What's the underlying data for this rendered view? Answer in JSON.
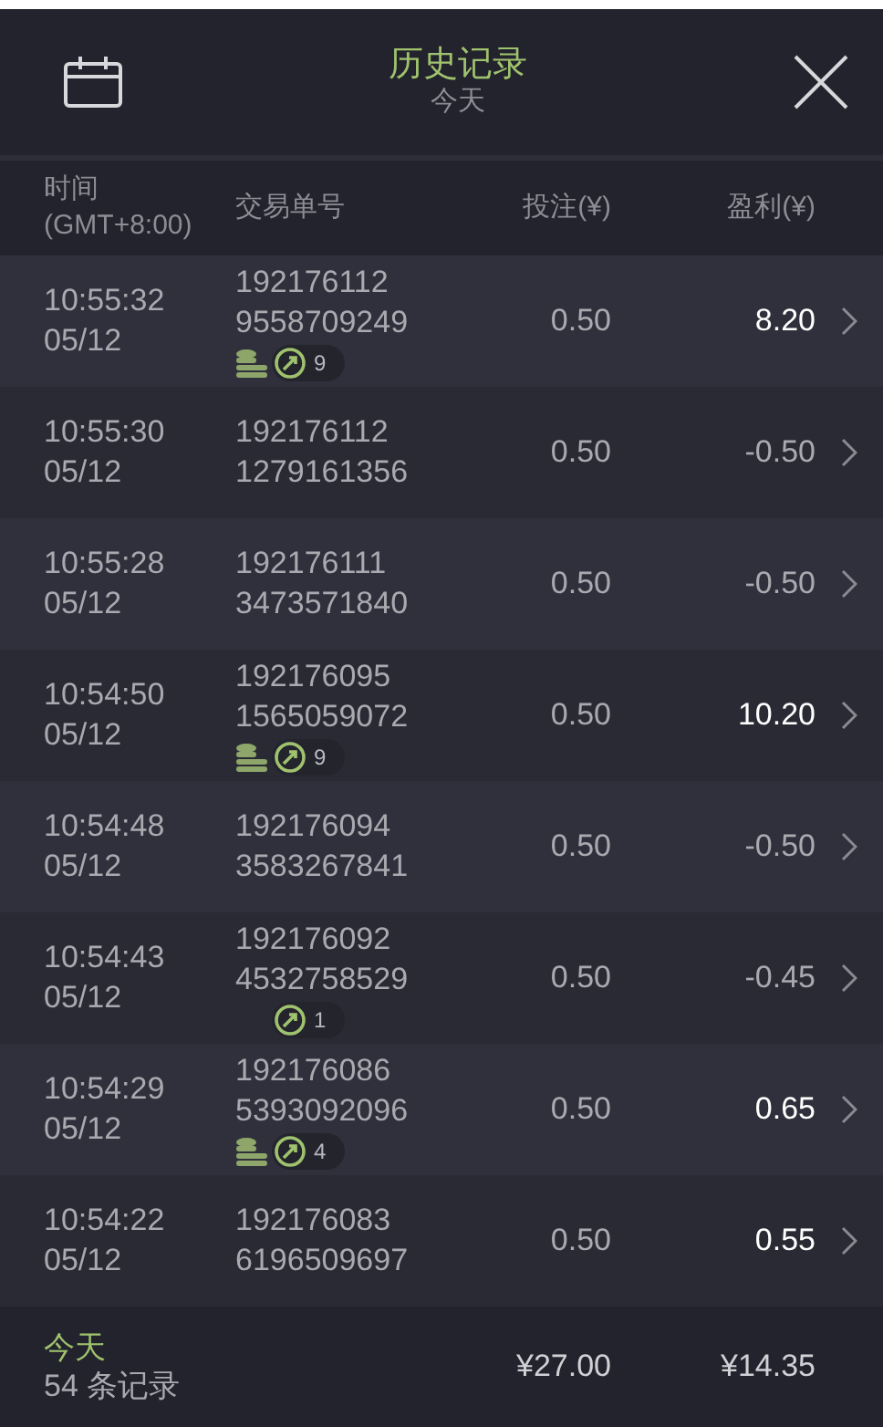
{
  "header": {
    "title": "历史记录",
    "subtitle": "今天"
  },
  "columns": [
    {
      "label": "时间\n(GMT+8:00)"
    },
    {
      "label": "交易单号"
    },
    {
      "label": "投注(¥)"
    },
    {
      "label": "盈利(¥)"
    }
  ],
  "rows": [
    {
      "time": "10:55:32",
      "date": "05/12",
      "order_1": "192176112",
      "order_2": "9558709249",
      "stake": "0.50",
      "profit": "8.20",
      "won": true,
      "coins": true,
      "count": "9"
    },
    {
      "time": "10:55:30",
      "date": "05/12",
      "order_1": "192176112",
      "order_2": "1279161356",
      "stake": "0.50",
      "profit": "-0.50",
      "won": false
    },
    {
      "time": "10:55:28",
      "date": "05/12",
      "order_1": "192176111",
      "order_2": "3473571840",
      "stake": "0.50",
      "profit": "-0.50",
      "won": false
    },
    {
      "time": "10:54:50",
      "date": "05/12",
      "order_1": "192176095",
      "order_2": "1565059072",
      "stake": "0.50",
      "profit": "10.20",
      "won": true,
      "coins": true,
      "count": "9"
    },
    {
      "time": "10:54:48",
      "date": "05/12",
      "order_1": "192176094",
      "order_2": "3583267841",
      "stake": "0.50",
      "profit": "-0.50",
      "won": false
    },
    {
      "time": "10:54:43",
      "date": "05/12",
      "order_1": "192176092",
      "order_2": "4532758529",
      "stake": "0.50",
      "profit": "-0.45",
      "won": false,
      "count": "1"
    },
    {
      "time": "10:54:29",
      "date": "05/12",
      "order_1": "192176086",
      "order_2": "5393092096",
      "stake": "0.50",
      "profit": "0.65",
      "won": true,
      "coins": true,
      "count": "4"
    },
    {
      "time": "10:54:22",
      "date": "05/12",
      "order_1": "192176083",
      "order_2": "6196509697",
      "stake": "0.50",
      "profit": "0.55",
      "won": true
    }
  ],
  "footer": {
    "period": "今天",
    "records": "54 条记录",
    "total_stake": "¥27.00",
    "total_profit": "¥14.35"
  }
}
